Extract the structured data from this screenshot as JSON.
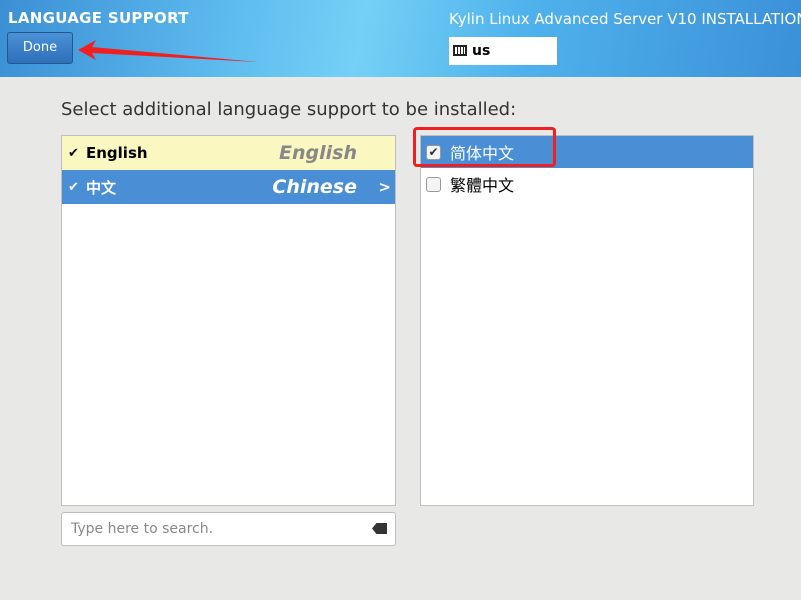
{
  "header": {
    "title": "LANGUAGE SUPPORT",
    "done_label": "Done",
    "product": "Kylin Linux Advanced Server V10 INSTALLATION",
    "keyboard": "us"
  },
  "prompt": "Select additional language support to be installed:",
  "languages": [
    {
      "native": "English",
      "english": "English",
      "checked": true
    },
    {
      "native": "中文",
      "english": "Chinese",
      "checked": true,
      "selected": true
    }
  ],
  "locales": [
    {
      "label": "简体中文",
      "checked": true
    },
    {
      "label": "繁體中文",
      "checked": false
    }
  ],
  "search": {
    "placeholder": "Type here to search."
  },
  "colors": {
    "selection": "#4a8fd6",
    "highlight": "#fbf7c0",
    "annotation": "#f02020"
  }
}
